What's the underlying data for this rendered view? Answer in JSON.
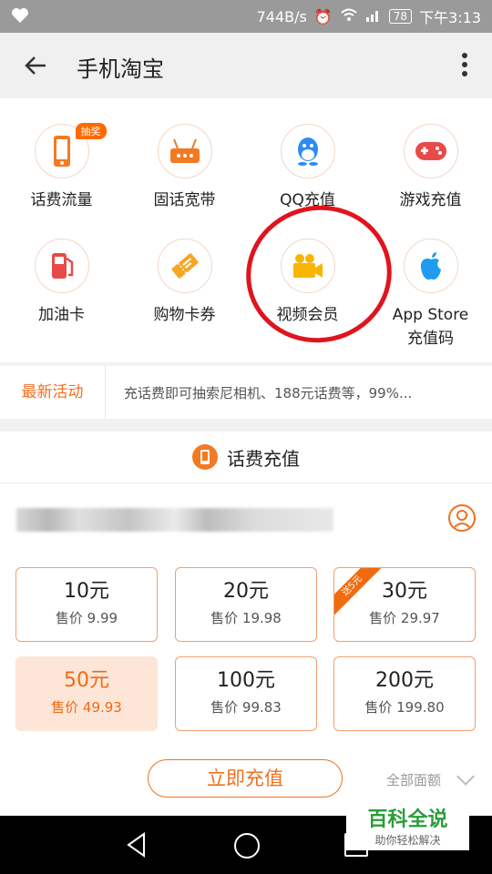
{
  "status": {
    "speed": "744B/s",
    "battery": "78",
    "time": "下午3:13"
  },
  "appbar": {
    "title": "手机淘宝"
  },
  "grid": {
    "badge": "抽奖",
    "items": [
      {
        "label": "话费流量",
        "icon": "phone-icon"
      },
      {
        "label": "固话宽带",
        "icon": "router-icon"
      },
      {
        "label": "QQ充值",
        "icon": "qq-penguin-icon"
      },
      {
        "label": "游戏充值",
        "icon": "gamepad-icon"
      },
      {
        "label": "加油卡",
        "icon": "fuel-icon"
      },
      {
        "label": "购物卡券",
        "icon": "ticket-icon"
      },
      {
        "label": "视频会员",
        "icon": "video-camera-icon"
      },
      {
        "label": "App Store",
        "label2": "充值码",
        "icon": "apple-icon"
      }
    ]
  },
  "activity": {
    "title": "最新活动",
    "text": "充话费即可抽索尼相机、188元话费等，99%..."
  },
  "recharge": {
    "title": "话费充值",
    "amounts": [
      {
        "value": "10元",
        "price": "售价 9.99"
      },
      {
        "value": "20元",
        "price": "售价 19.98"
      },
      {
        "value": "30元",
        "price": "售价 29.97",
        "ribbon": "送5元"
      },
      {
        "value": "50元",
        "price": "售价 49.93",
        "selected": true
      },
      {
        "value": "100元",
        "price": "售价 99.83"
      },
      {
        "value": "200元",
        "price": "售价 199.80"
      }
    ],
    "button": "立即充值",
    "all_amounts": "全部面额"
  },
  "watermark": {
    "title": "百科全说",
    "sub": "助你轻松解决"
  },
  "colors": {
    "accent": "#f07020",
    "annotation": "#e0141e"
  }
}
